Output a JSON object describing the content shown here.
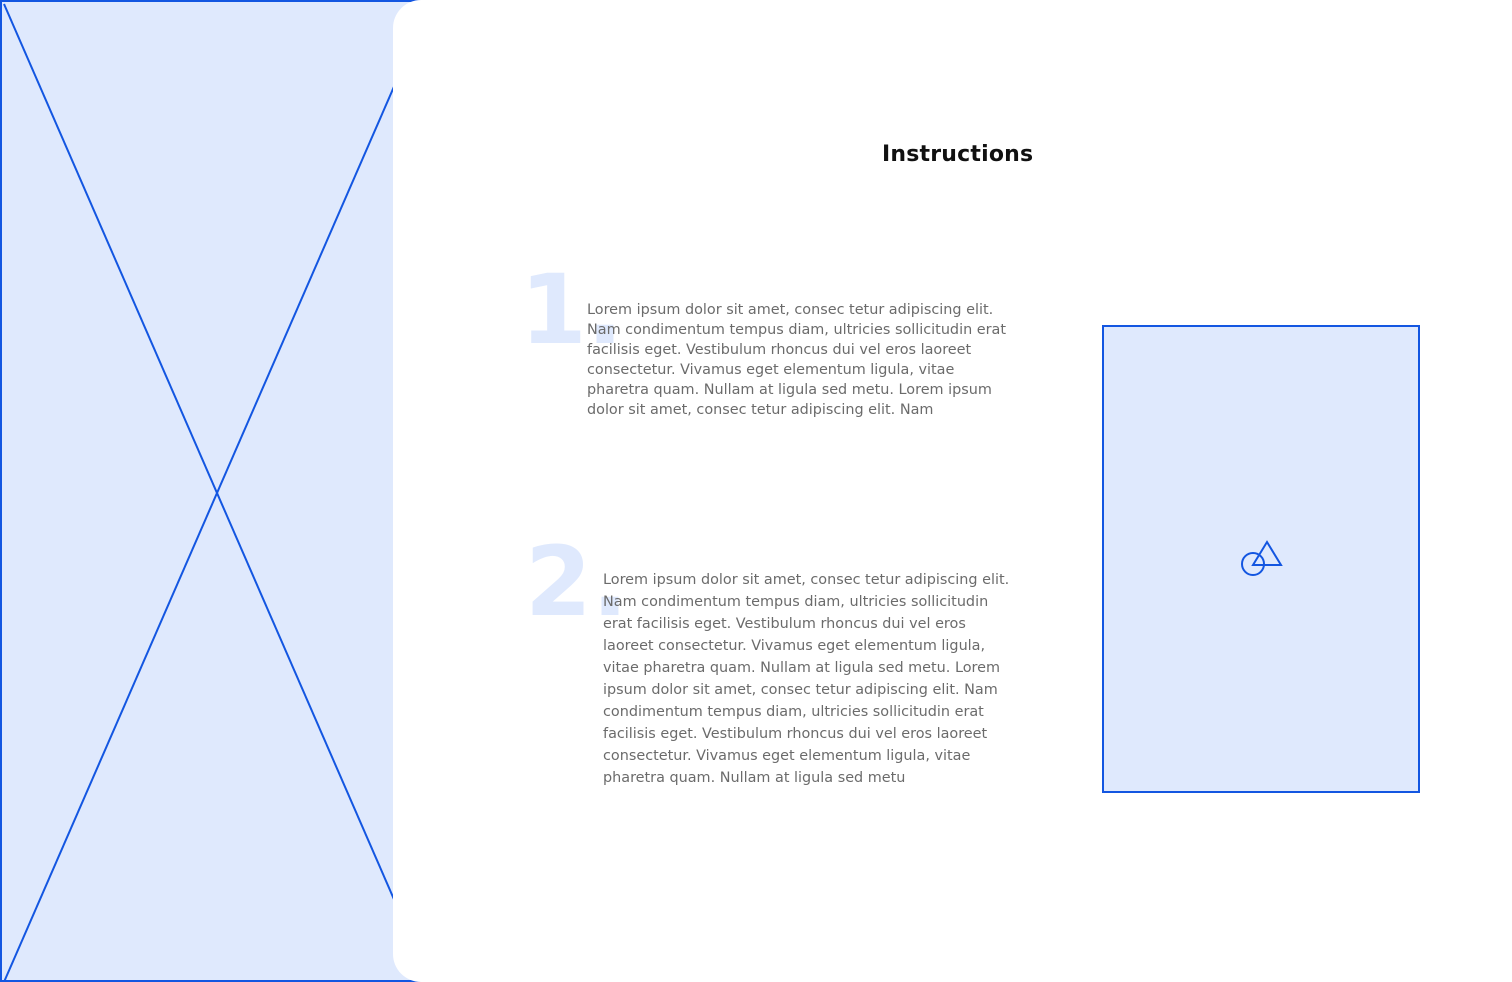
{
  "page": {
    "title": "Instructions"
  },
  "media_placeholder": {
    "icon": "image-placeholder-icon",
    "color_fill": "#dfe9fd",
    "color_stroke": "#1356e1"
  },
  "steps": [
    {
      "number": "1.",
      "text": "Lorem ipsum dolor sit amet, consec tetur adipiscing elit. Nam condimentum tempus diam, ultricies sollicitudin erat facilisis eget. Vestibulum rhoncus dui vel eros laoreet consectetur. Vivamus eget elementum ligula, vitae pharetra quam. Nullam at ligula sed metu. Lorem ipsum dolor sit amet, consec tetur adipiscing elit. Nam"
    },
    {
      "number": "2.",
      "text": "Lorem ipsum dolor sit amet, consec tetur adipiscing elit. Nam condimentum tempus diam, ultricies sollicitudin erat facilisis eget. Vestibulum rhoncus dui vel eros laoreet consectetur. Vivamus eget elementum ligula, vitae pharetra quam. Nullam at ligula sed metu. Lorem ipsum dolor sit amet, consec tetur adipiscing elit. Nam condimentum tempus diam, ultricies sollicitudin erat facilisis eget. Vestibulum rhoncus dui vel eros laoreet consectetur. Vivamus eget elementum ligula, vitae pharetra quam. Nullam at ligula sed metu"
    }
  ],
  "colors": {
    "accent": "#1356e1",
    "placeholder_fill": "#dfe9fd",
    "body_text": "#6b6b6b",
    "heading": "#111111"
  }
}
